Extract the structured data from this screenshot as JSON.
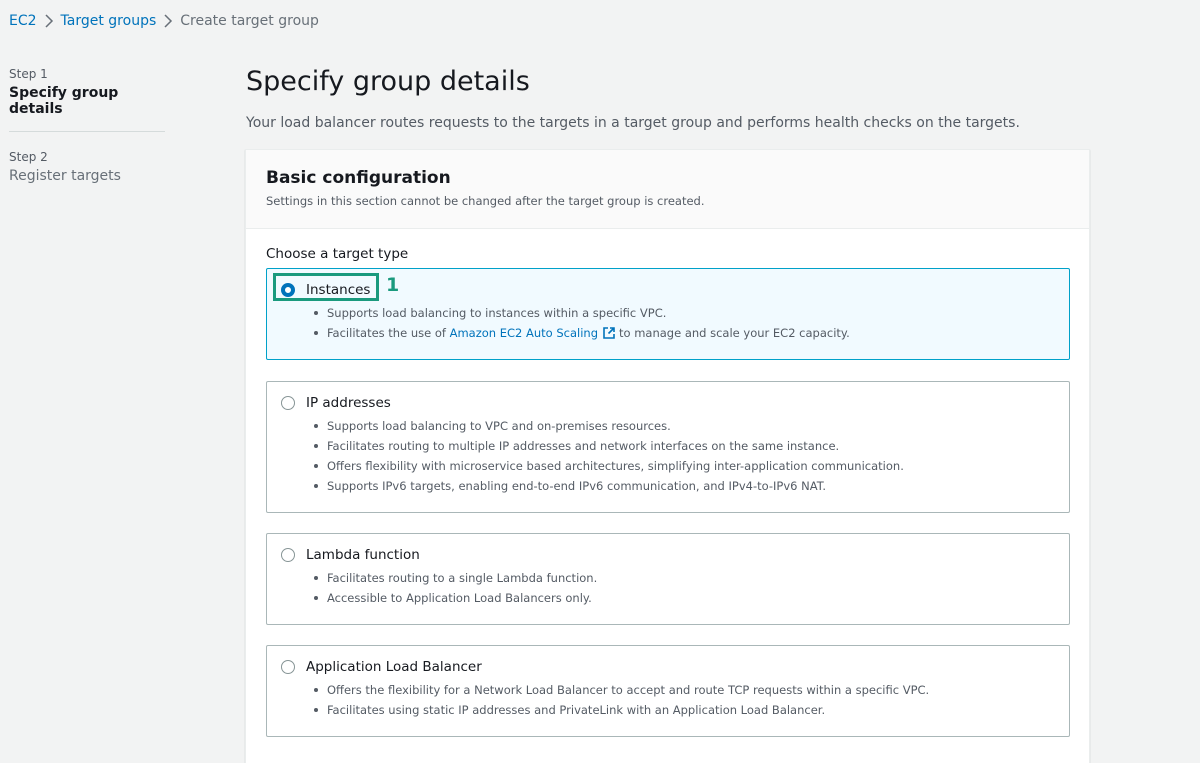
{
  "breadcrumb": {
    "items": [
      "EC2",
      "Target groups"
    ],
    "current": "Create target group"
  },
  "steps": [
    {
      "number": "Step 1",
      "title": "Specify group details"
    },
    {
      "number": "Step 2",
      "title": "Register targets"
    }
  ],
  "page": {
    "title": "Specify group details",
    "description": "Your load balancer routes requests to the targets in a target group and performs health checks on the targets."
  },
  "basic_config": {
    "title": "Basic configuration",
    "subtitle": "Settings in this section cannot be changed after the target group is created.",
    "target_type_label": "Choose a target type",
    "options": [
      {
        "label": "Instances",
        "selected": true,
        "bullets": [
          "Supports load balancing to instances within a specific VPC."
        ],
        "bullet_with_link": {
          "before": "Facilitates the use of ",
          "link": "Amazon EC2 Auto Scaling",
          "after": "to manage and scale your EC2 capacity."
        }
      },
      {
        "label": "IP addresses",
        "selected": false,
        "bullets": [
          "Supports load balancing to VPC and on-premises resources.",
          "Facilitates routing to multiple IP addresses and network interfaces on the same instance.",
          "Offers flexibility with microservice based architectures, simplifying inter-application communication.",
          "Supports IPv6 targets, enabling end-to-end IPv6 communication, and IPv4-to-IPv6 NAT."
        ]
      },
      {
        "label": "Lambda function",
        "selected": false,
        "bullets": [
          "Facilitates routing to a single Lambda function.",
          "Accessible to Application Load Balancers only."
        ]
      },
      {
        "label": "Application Load Balancer",
        "selected": false,
        "bullets": [
          "Offers the flexibility for a Network Load Balancer to accept and route TCP requests within a specific VPC.",
          "Facilitates using static IP addresses and PrivateLink with an Application Load Balancer."
        ]
      }
    ]
  },
  "annotation": {
    "number": "1"
  },
  "colors": {
    "link": "#0073bb",
    "selected_border": "#00a1c9",
    "annotation": "#1a9a7e"
  }
}
